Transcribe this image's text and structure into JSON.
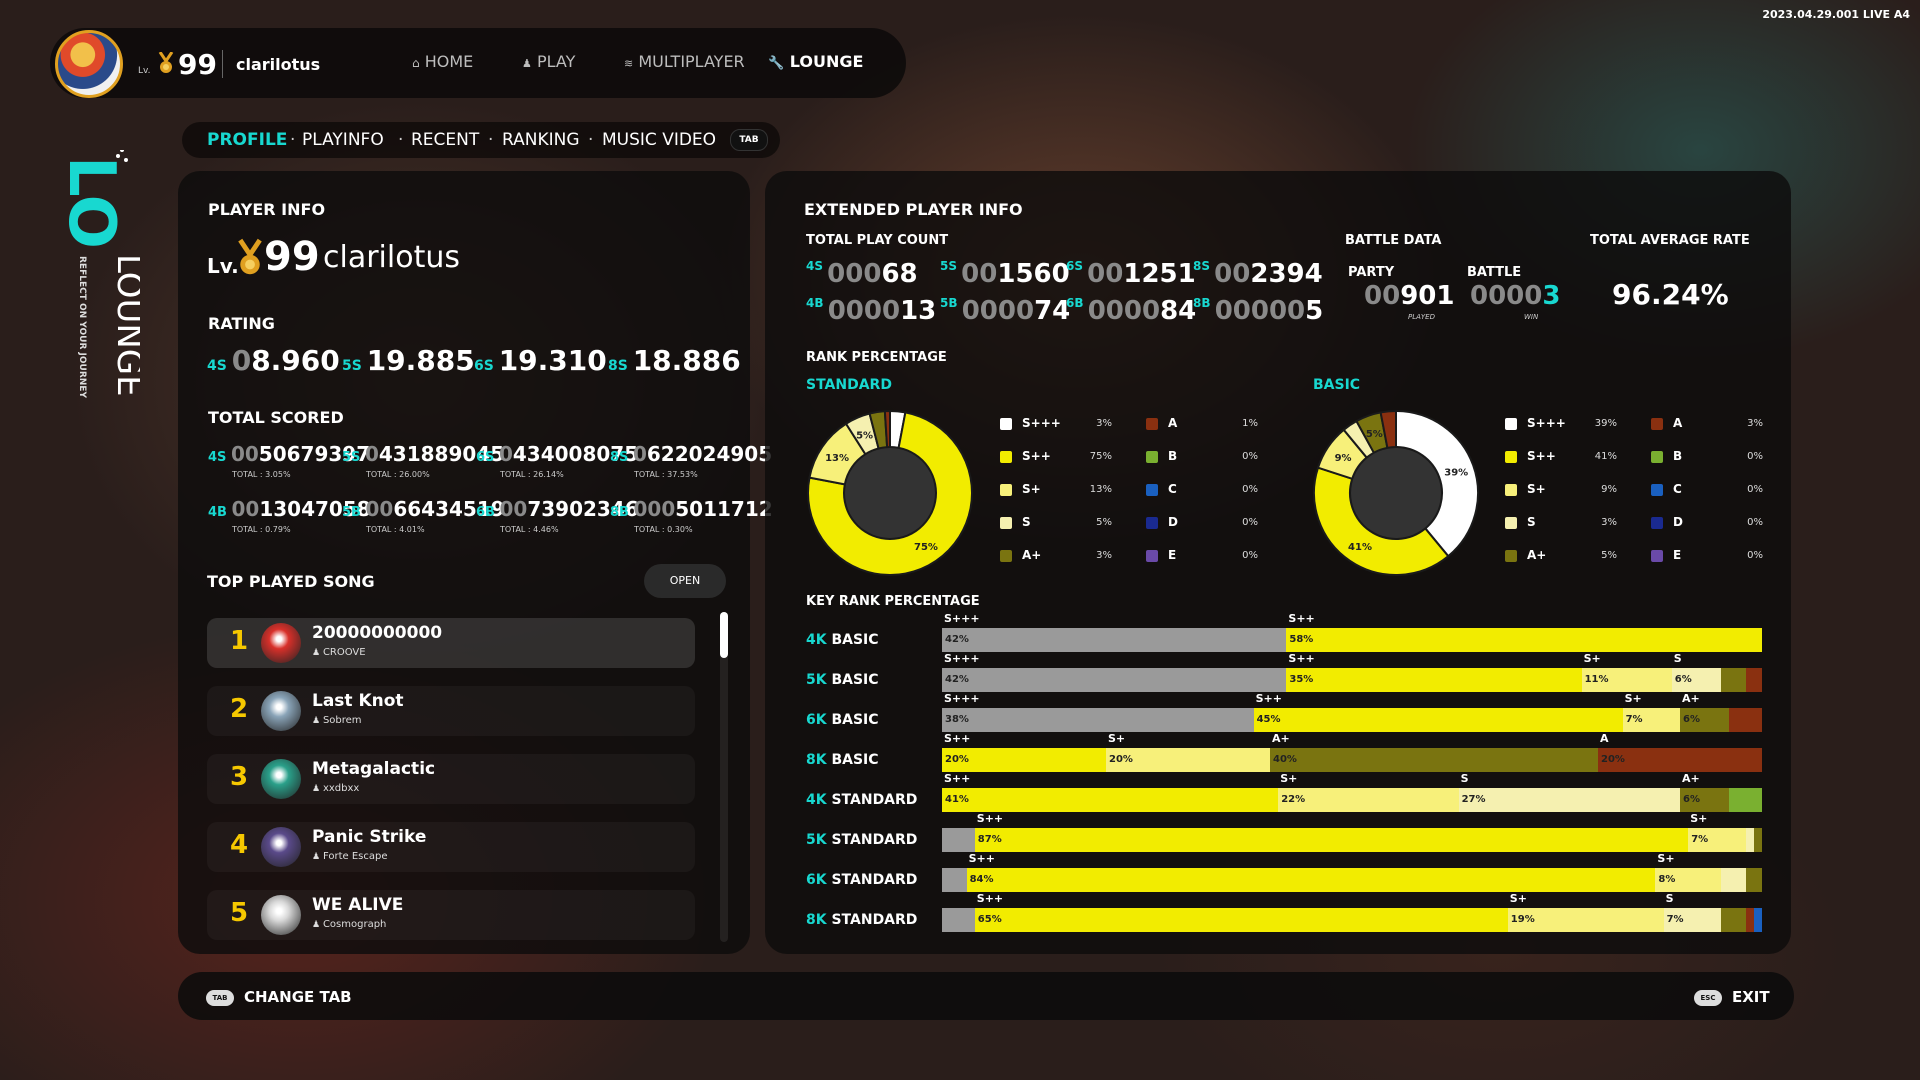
{
  "version": "2023.04.29.001 LIVE A4",
  "header": {
    "level_prefix": "Lv.",
    "level": "99",
    "username": "clarilotus",
    "nav": [
      "HOME",
      "PLAY",
      "MULTIPLAYER",
      "LOUNGE"
    ],
    "active_nav": "LOUNGE"
  },
  "side_title": {
    "big": "LO",
    "word": "LOUNGE",
    "tagline": "REFLECT ON YOUR JOURNEY"
  },
  "subtabs": [
    "PROFILE",
    "PLAYINFO",
    "RECENT",
    "RANKING",
    "MUSIC VIDEO"
  ],
  "tab_key": "TAB",
  "player_info": {
    "title": "PLAYER INFO",
    "level_prefix": "Lv.",
    "level": "99",
    "name": "clarilotus",
    "rating_title": "RATING",
    "ratings": [
      {
        "key": "4S",
        "dim": "0",
        "value": "8.960"
      },
      {
        "key": "5S",
        "dim": "",
        "value": "19.885"
      },
      {
        "key": "6S",
        "dim": "",
        "value": "19.310"
      },
      {
        "key": "8S",
        "dim": "",
        "value": "18.886"
      }
    ],
    "total_scored_title": "TOTAL SCORED",
    "scored": [
      {
        "key": "4S",
        "dim": "00",
        "value": "50679397",
        "total": "TOTAL : 3.05%"
      },
      {
        "key": "5S",
        "dim": "0",
        "value": "431889045",
        "total": "TOTAL : 26.00%"
      },
      {
        "key": "6S",
        "dim": "0",
        "value": "434008075",
        "total": "TOTAL : 26.14%"
      },
      {
        "key": "8S",
        "dim": "0",
        "value": "622024905",
        "total": "TOTAL : 37.53%"
      },
      {
        "key": "4B",
        "dim": "00",
        "value": "13047058",
        "total": "TOTAL : 0.79%"
      },
      {
        "key": "5B",
        "dim": "00",
        "value": "66434519",
        "total": "TOTAL : 4.01%"
      },
      {
        "key": "6B",
        "dim": "00",
        "value": "73902346",
        "total": "TOTAL : 4.46%"
      },
      {
        "key": "8B",
        "dim": "000",
        "value": "5011712",
        "total": "TOTAL : 0.30%"
      }
    ]
  },
  "top_played": {
    "title": "TOP PLAYED SONG",
    "open_label": "OPEN",
    "songs": [
      {
        "rank": "1",
        "title": "20000000000",
        "artist": "CROOVE",
        "color": "#d8302a"
      },
      {
        "rank": "2",
        "title": "Last Knot",
        "artist": "Sobrem",
        "color": "#8aa4b8"
      },
      {
        "rank": "3",
        "title": "Metagalactic",
        "artist": "xxdbxx",
        "color": "#2aa08a"
      },
      {
        "rank": "4",
        "title": "Panic Strike",
        "artist": "Forte Escape",
        "color": "#5a4a8a"
      },
      {
        "rank": "5",
        "title": "WE ALIVE",
        "artist": "Cosmograph",
        "color": "#d8d8d8"
      }
    ]
  },
  "extended": {
    "title": "EXTENDED PLAYER INFO",
    "play_count_title": "TOTAL PLAY COUNT",
    "play_counts": [
      {
        "key": "4S",
        "dim": "000",
        "value": "68"
      },
      {
        "key": "5S",
        "dim": "00",
        "value": "1560"
      },
      {
        "key": "6S",
        "dim": "00",
        "value": "1251"
      },
      {
        "key": "8S",
        "dim": "00",
        "value": "2394"
      },
      {
        "key": "4B",
        "dim": "0000",
        "value": "13"
      },
      {
        "key": "5B",
        "dim": "0000",
        "value": "74"
      },
      {
        "key": "6B",
        "dim": "0000",
        "value": "84"
      },
      {
        "key": "8B",
        "dim": "00000",
        "value": "5"
      }
    ],
    "battle_title": "BATTLE DATA",
    "party_label": "PARTY",
    "party_dim": "00",
    "party_value": "901",
    "party_sub": "PLAYED",
    "battle_label": "BATTLE",
    "battle_dim": "0000",
    "battle_value": "3",
    "battle_sub": "WIN",
    "avg_title": "TOTAL AVERAGE RATE",
    "avg_value": "96.24%",
    "rank_pct_title": "RANK PERCENTAGE",
    "key_rank_title": "KEY RANK PERCENTAGE"
  },
  "colors": {
    "S+++": "#ffffff",
    "S++": "#f2ec00",
    "S+": "#f7f07a",
    "S": "#f5f0b0",
    "A+": "#7a7410",
    "A": "#8a3010",
    "B": "#7ab030",
    "C": "#1a60c0",
    "D": "#1a2a90",
    "E": "#6a4aa8",
    "gray": "#9a9a9a",
    "accent": "#18d8d0"
  },
  "chart_data": [
    {
      "type": "pie",
      "title": "STANDARD",
      "categories": [
        "S+++",
        "S++",
        "S+",
        "S",
        "A+",
        "A",
        "B",
        "C",
        "D",
        "E"
      ],
      "values": [
        3,
        75,
        13,
        5,
        3,
        1,
        0,
        0,
        0,
        0
      ],
      "labels": [
        "3%",
        "75%",
        "13%",
        "5%",
        "3%",
        "1%",
        "0%",
        "0%",
        "0%",
        "0%"
      ]
    },
    {
      "type": "pie",
      "title": "BASIC",
      "categories": [
        "S+++",
        "S++",
        "S+",
        "S",
        "A+",
        "A",
        "B",
        "C",
        "D",
        "E"
      ],
      "values": [
        39,
        41,
        9,
        3,
        5,
        3,
        0,
        0,
        0,
        0
      ],
      "labels": [
        "39%",
        "41%",
        "9%",
        "3%",
        "5%",
        "3%",
        "0%",
        "0%",
        "0%",
        "0%"
      ]
    },
    {
      "type": "bar",
      "title": "KEY RANK PERCENTAGE",
      "rows": [
        {
          "key": "4K",
          "mode": "BASIC",
          "segments": [
            {
              "rank": "S+++",
              "value": 42,
              "label": "42%"
            },
            {
              "rank": "S++",
              "value": 58,
              "label": "58%"
            }
          ]
        },
        {
          "key": "5K",
          "mode": "BASIC",
          "segments": [
            {
              "rank": "S+++",
              "value": 42,
              "label": "42%"
            },
            {
              "rank": "S++",
              "value": 36,
              "label": "35%"
            },
            {
              "rank": "S+",
              "value": 11,
              "label": "11%"
            },
            {
              "rank": "S",
              "value": 6,
              "label": "6%"
            },
            {
              "rank": "A+",
              "value": 3,
              "label": ""
            },
            {
              "rank": "A",
              "value": 2,
              "label": ""
            }
          ]
        },
        {
          "key": "6K",
          "mode": "BASIC",
          "segments": [
            {
              "rank": "S+++",
              "value": 38,
              "label": "38%"
            },
            {
              "rank": "S++",
              "value": 45,
              "label": "45%"
            },
            {
              "rank": "S+",
              "value": 7,
              "label": "7%"
            },
            {
              "rank": "A+",
              "value": 6,
              "label": "6%"
            },
            {
              "rank": "A",
              "value": 4,
              "label": ""
            }
          ]
        },
        {
          "key": "8K",
          "mode": "BASIC",
          "segments": [
            {
              "rank": "S++",
              "value": 20,
              "label": "20%"
            },
            {
              "rank": "S+",
              "value": 20,
              "label": "20%"
            },
            {
              "rank": "A+",
              "value": 40,
              "label": "40%"
            },
            {
              "rank": "A",
              "value": 20,
              "label": "20%"
            }
          ]
        },
        {
          "key": "4K",
          "mode": "STANDARD",
          "segments": [
            {
              "rank": "S++",
              "value": 41,
              "label": "41%"
            },
            {
              "rank": "S+",
              "value": 22,
              "label": "22%"
            },
            {
              "rank": "S",
              "value": 27,
              "label": "27%"
            },
            {
              "rank": "A+",
              "value": 6,
              "label": "6%"
            },
            {
              "rank": "B",
              "value": 4,
              "label": ""
            }
          ]
        },
        {
          "key": "5K",
          "mode": "STANDARD",
          "segments": [
            {
              "rank": "S+++",
              "value": 4,
              "label": ""
            },
            {
              "rank": "S++",
              "value": 87,
              "label": "87%"
            },
            {
              "rank": "S+",
              "value": 7,
              "label": "7%"
            },
            {
              "rank": "S",
              "value": 1,
              "label": ""
            },
            {
              "rank": "A+",
              "value": 1,
              "label": ""
            }
          ]
        },
        {
          "key": "6K",
          "mode": "STANDARD",
          "segments": [
            {
              "rank": "S+++",
              "value": 3,
              "label": ""
            },
            {
              "rank": "S++",
              "value": 84,
              "label": "84%"
            },
            {
              "rank": "S+",
              "value": 8,
              "label": "8%"
            },
            {
              "rank": "S",
              "value": 3,
              "label": ""
            },
            {
              "rank": "A+",
              "value": 2,
              "label": ""
            }
          ]
        },
        {
          "key": "8K",
          "mode": "STANDARD",
          "segments": [
            {
              "rank": "S+++",
              "value": 4,
              "label": ""
            },
            {
              "rank": "S++",
              "value": 65,
              "label": "65%"
            },
            {
              "rank": "S+",
              "value": 19,
              "label": "19%"
            },
            {
              "rank": "S",
              "value": 7,
              "label": "7%"
            },
            {
              "rank": "A+",
              "value": 3,
              "label": ""
            },
            {
              "rank": "A",
              "value": 1,
              "label": ""
            },
            {
              "rank": "C",
              "value": 1,
              "label": ""
            }
          ]
        }
      ],
      "shown_rank_labels": [
        [
          "S+++",
          "S++"
        ],
        [
          "S+++",
          "S++",
          "S+",
          "S"
        ],
        [
          "S+++",
          "S++",
          "S+",
          "A+"
        ],
        [
          "S++",
          "S+",
          "A+",
          "A"
        ],
        [
          "S++",
          "S+",
          "S",
          "A+"
        ],
        [
          "S++",
          "S+"
        ],
        [
          "S++",
          "S+"
        ],
        [
          "S++",
          "S+",
          "S"
        ]
      ]
    }
  ],
  "legend": {
    "left": [
      "S+++",
      "S++",
      "S+",
      "S",
      "A+"
    ],
    "right": [
      "A",
      "B",
      "C",
      "D",
      "E"
    ]
  },
  "footer": {
    "change_tab_key": "TAB",
    "change_tab_label": "CHANGE TAB",
    "exit_key": "ESC",
    "exit_label": "EXIT"
  }
}
